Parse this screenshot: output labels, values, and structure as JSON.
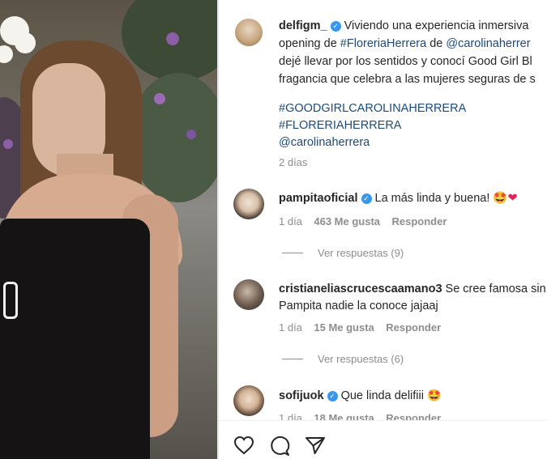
{
  "post": {
    "author": "delfigm_",
    "caption_lines": [
      "Viviendo una experiencia inmersiva",
      "opening de ",
      "dejé llevar por los sentidos y conocí Good Girl Bl",
      "fragancia que celebra a las mujeres seguras de s"
    ],
    "caption_link_hashtag": "#FloreriaHerrera",
    "caption_between": " de ",
    "caption_link_mention": "@carolinaherrer",
    "hashtags": [
      "#GOODGIRLCAROLINAHERRERA",
      "#FLORERIAHERRERA",
      "@carolinaherrera"
    ],
    "age": "2 días"
  },
  "comments": [
    {
      "username": "pampitaoficial",
      "verified": true,
      "text": "La más linda y buena!",
      "emoji": "🤩❤",
      "age": "1 día",
      "likes": "463 Me gusta",
      "reply_label": "Responder",
      "view_replies": "Ver respuestas (9)"
    },
    {
      "username": "cristianeliascrucescaamano3",
      "verified": false,
      "text": "Se cree famosa sin",
      "text_line2": "Pampita nadie la conoce jajaaj",
      "age": "1 día",
      "likes": "15 Me gusta",
      "reply_label": "Responder",
      "view_replies": "Ver respuestas (6)"
    },
    {
      "username": "sofijuok",
      "verified": true,
      "text": "Que linda delifiii",
      "emoji": "🤩",
      "age": "1 día",
      "likes": "18 Me gusta",
      "reply_label": "Responder"
    }
  ],
  "actions": [
    "like-icon",
    "comment-icon",
    "share-icon"
  ]
}
